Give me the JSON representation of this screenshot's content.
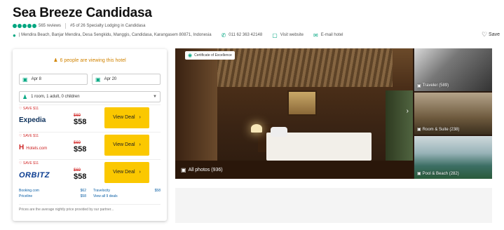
{
  "colors": {
    "accent": "#00a680",
    "deal_button": "#fbc800",
    "save_red": "#d32f2f",
    "link_blue": "#0b5fa5"
  },
  "hotel": {
    "name": "Sea Breeze Candidasa",
    "rating_bubbles": 5,
    "reviews": "565 reviews",
    "ranking": "#5 of 26 Specialty Lodging in Candidasa",
    "address": "| Mendira Beach, Banjar Mendira, Desa Sengkidu, Manggis, Candidasa, Karangasem 80871, Indonesia",
    "phone": "011 62 363 42148",
    "visit_website": "Visit website",
    "email_hotel": "E-mail hotel",
    "save": "Save"
  },
  "booking": {
    "viewing_now": "6 people are viewing this hotel",
    "check_in": "Apr 8",
    "check_out": "Apr 20",
    "guests": "1 room, 1 adult, 0 children",
    "offers": [
      {
        "save_tag": "SAVE $11",
        "provider": "Expedia",
        "old_price": "$69",
        "price": "$58",
        "button": "View Deal"
      },
      {
        "save_tag": "SAVE $11",
        "provider": "Hotels.com",
        "old_price": "$69",
        "price": "$58",
        "button": "View Deal"
      },
      {
        "save_tag": "SAVE $11",
        "provider": "ORBITZ",
        "old_price": "$69",
        "price": "$58",
        "button": "View Deal"
      }
    ],
    "more_prices": [
      {
        "name": "Booking.com",
        "price": "$62"
      },
      {
        "name": "Travelocity",
        "price": "$58"
      },
      {
        "name": "Priceline",
        "price": "$58"
      }
    ],
    "view_all": "View all 9 deals",
    "footnote": "Prices are the average nightly price provided by our partner..."
  },
  "gallery": {
    "badge": "Certificate of Excellence",
    "all_photos": "All photos (936)",
    "thumbs": [
      {
        "label": "Traveler (589)"
      },
      {
        "label": "Room & Suite (238)"
      },
      {
        "label": "Pool & Beach (282)"
      }
    ]
  }
}
